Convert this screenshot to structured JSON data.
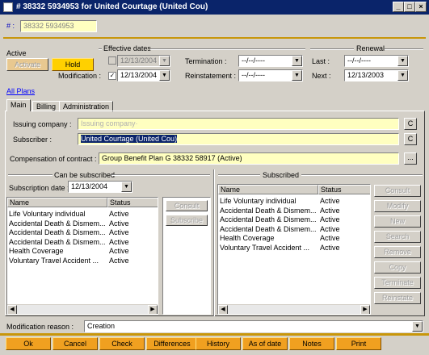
{
  "window": {
    "title": "# 38332 5934953 for United Courtage (United Cou)",
    "min": "_",
    "max": "□",
    "close": "×"
  },
  "header": {
    "hash_label": "# :",
    "number": "38332 5934953"
  },
  "active": {
    "label": "Active",
    "activate_btn": "Activate",
    "hold_btn": "Hold"
  },
  "effective": {
    "group_label": "Effective dates",
    "date1": "12/13/2004",
    "modification_label": "Modification :",
    "date2": "12/13/2004",
    "termination_label": "Termination :",
    "termination_value": "--/--/----",
    "reinstatement_label": "Reinstatement :",
    "reinstatement_value": "--/--/----"
  },
  "renewal": {
    "group_label": "Renewal",
    "last_label": "Last :",
    "last_value": "--/--/----",
    "next_label": "Next :",
    "next_value": "12/13/2003"
  },
  "all_plans": "All Plans",
  "tabs": [
    "Main",
    "Billing",
    "Administration"
  ],
  "main": {
    "issuing_label": "Issuing company :",
    "issuing_placeholder": "Issuing company·",
    "subscriber_label": "Subscriber :",
    "subscriber_value": "United Courtage (United Cou)",
    "compensation_label": "Compensation of contract :",
    "compensation_value": "Group Benefit Plan G 38332 58917 (Active)",
    "c_btn": "C",
    "ellipsis_btn": "..."
  },
  "can_subscribe": {
    "group_label": "Can be subscribed",
    "date_label": "Subscription date :",
    "date_value": "12/13/2004",
    "col_name": "Name",
    "col_status": "Status",
    "rows": [
      {
        "name": "Life Voluntary individual",
        "status": "Active"
      },
      {
        "name": "Accidental Death & Dismem...",
        "status": "Active"
      },
      {
        "name": "Accidental Death & Dismem...",
        "status": "Active"
      },
      {
        "name": "Accidental Death & Dismem...",
        "status": "Active"
      },
      {
        "name": "Health Coverage",
        "status": "Active"
      },
      {
        "name": "Voluntary Travel Accident ...",
        "status": "Active"
      }
    ],
    "consult_btn": "Consult",
    "subscribe_btn": "Subscribe"
  },
  "subscribed": {
    "group_label": "Subscribed",
    "col_name": "Name",
    "col_status": "Status",
    "rows": [
      {
        "name": "Life Voluntary individual",
        "status": "Active"
      },
      {
        "name": "Accidental Death & Dismem...",
        "status": "Active"
      },
      {
        "name": "Accidental Death & Dismem...",
        "status": "Active"
      },
      {
        "name": "Accidental Death & Dismem...",
        "status": "Active"
      },
      {
        "name": "Health Coverage",
        "status": "Active"
      },
      {
        "name": "Voluntary Travel Accident ...",
        "status": "Active"
      }
    ],
    "buttons": [
      "Consult",
      "Modify",
      "New",
      "Search",
      "Remove",
      "Copy",
      "Terminate",
      "Reinstate"
    ]
  },
  "modification": {
    "label": "Modification reason :",
    "value": "Creation"
  },
  "footer": [
    "Ok",
    "Cancel",
    "Check",
    "Differences",
    "History",
    "As of date",
    "Notes",
    "Print"
  ]
}
